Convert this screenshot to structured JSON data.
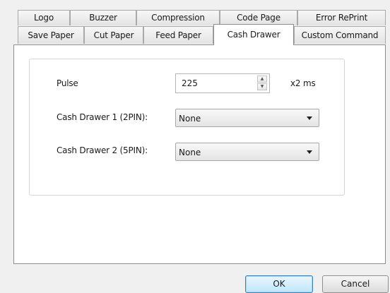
{
  "tabs": {
    "row1": [
      "Logo",
      "Buzzer",
      "Compression",
      "Code Page",
      "Error RePrint"
    ],
    "row2": [
      "Save Paper",
      "Cut Paper",
      "Feed Paper",
      "Cash Drawer",
      "Custom Command"
    ],
    "active": "Cash Drawer"
  },
  "cash_drawer": {
    "pulse_label": "Pulse",
    "pulse_value": "225",
    "pulse_unit": "x2 ms",
    "drawer1_label": "Cash Drawer 1 (2PIN):",
    "drawer1_value": "None",
    "drawer2_label": "Cash Drawer 2 (5PIN):",
    "drawer2_value": "None"
  },
  "buttons": {
    "ok_label": "OK",
    "cancel_label": "Cancel"
  },
  "icons": {
    "spin_up": "spin-up-arrow",
    "spin_down": "spin-down-arrow",
    "dropdown": "dropdown-arrow"
  }
}
